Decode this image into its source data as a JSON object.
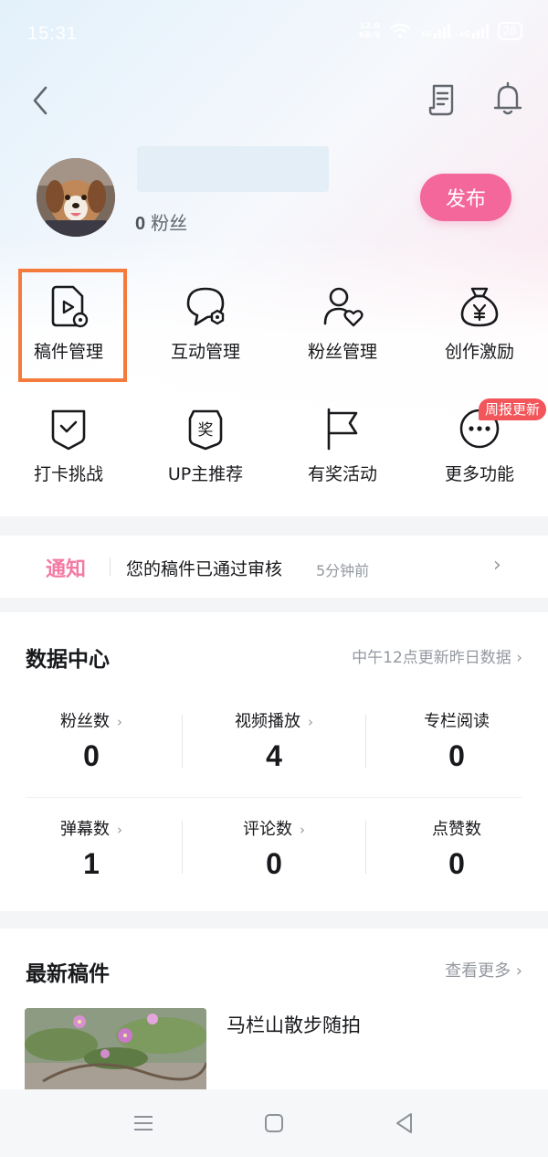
{
  "status_bar": {
    "time": "15:31",
    "net_speed_value": "12.0",
    "net_speed_unit": "KB/S",
    "signal_1": "4G",
    "signal_2": "4G",
    "battery": "28"
  },
  "profile": {
    "fans_count": "0",
    "fans_label": "粉丝",
    "publish_label": "发布"
  },
  "tools": [
    {
      "label": "稿件管理",
      "icon": "manuscript-icon"
    },
    {
      "label": "互动管理",
      "icon": "interaction-icon"
    },
    {
      "label": "粉丝管理",
      "icon": "fans-icon"
    },
    {
      "label": "创作激励",
      "icon": "money-bag-icon"
    },
    {
      "label": "打卡挑战",
      "icon": "shield-check-icon"
    },
    {
      "label": "UP主推荐",
      "icon": "award-shield-icon"
    },
    {
      "label": "有奖活动",
      "icon": "flag-icon"
    },
    {
      "label": "更多功能",
      "icon": "more-icon"
    }
  ],
  "weekly_badge": "周报更新",
  "notice": {
    "tag": "通知",
    "text": "您的稿件已通过审核",
    "time": "5分钟前",
    "arrow": "›"
  },
  "data_center": {
    "title": "数据中心",
    "hint": "中午12点更新昨日数据 ›",
    "stats": [
      {
        "label": "粉丝数",
        "value": "0",
        "has_arrow": true
      },
      {
        "label": "视频播放",
        "value": "4",
        "has_arrow": true
      },
      {
        "label": "专栏阅读",
        "value": "0",
        "has_arrow": false
      },
      {
        "label": "弹幕数",
        "value": "1",
        "has_arrow": true
      },
      {
        "label": "评论数",
        "value": "0",
        "has_arrow": true
      },
      {
        "label": "点赞数",
        "value": "0",
        "has_arrow": false
      }
    ],
    "arrow": "›"
  },
  "recent": {
    "title": "最新稿件",
    "more": "查看更多 ›",
    "video_title": "马栏山散步随拍"
  },
  "colors": {
    "accent_pink": "#f3679b",
    "notice_pink": "#f47aa2",
    "highlight_orange": "#f47b3c",
    "badge_red": "#f2555a"
  }
}
